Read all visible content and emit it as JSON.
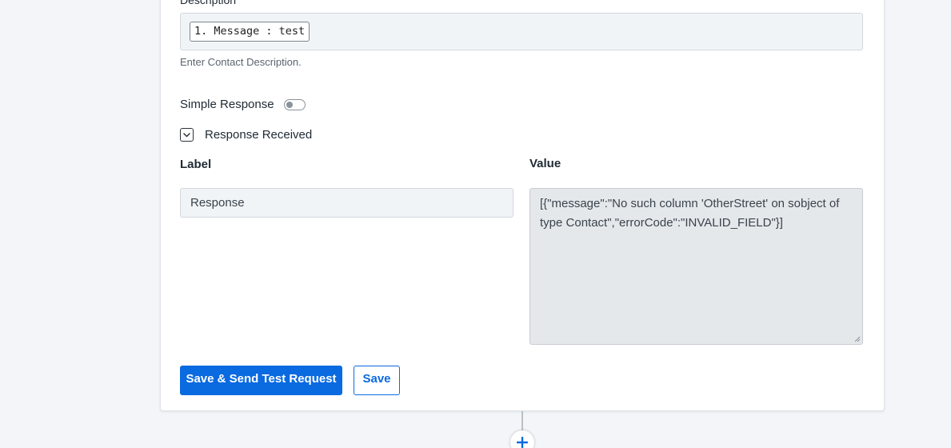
{
  "description": {
    "label": "Description",
    "token_text": "1. Message : test",
    "hint": "Enter Contact Description."
  },
  "simple_response": {
    "label": "Simple Response",
    "enabled": false
  },
  "response_received": {
    "label": "Response Received",
    "expanded": true
  },
  "table": {
    "label_header": "Label",
    "value_header": "Value",
    "label_value": "Response",
    "value_text": "[{\"message\":\"No such column 'OtherStreet' on sobject of type Contact\",\"errorCode\":\"INVALID_FIELD\"}]"
  },
  "buttons": {
    "save_send": "Save & Send Test Request",
    "save": "Save"
  },
  "colors": {
    "accent": "#0a6ae0",
    "background": "#f3f5f8",
    "input_bg": "#f1f4f7",
    "disabled_bg": "#e5e8eb"
  },
  "icons": {
    "toggle": "toggle-switch-icon",
    "chevron": "chevron-down-icon",
    "add": "plus-icon"
  }
}
